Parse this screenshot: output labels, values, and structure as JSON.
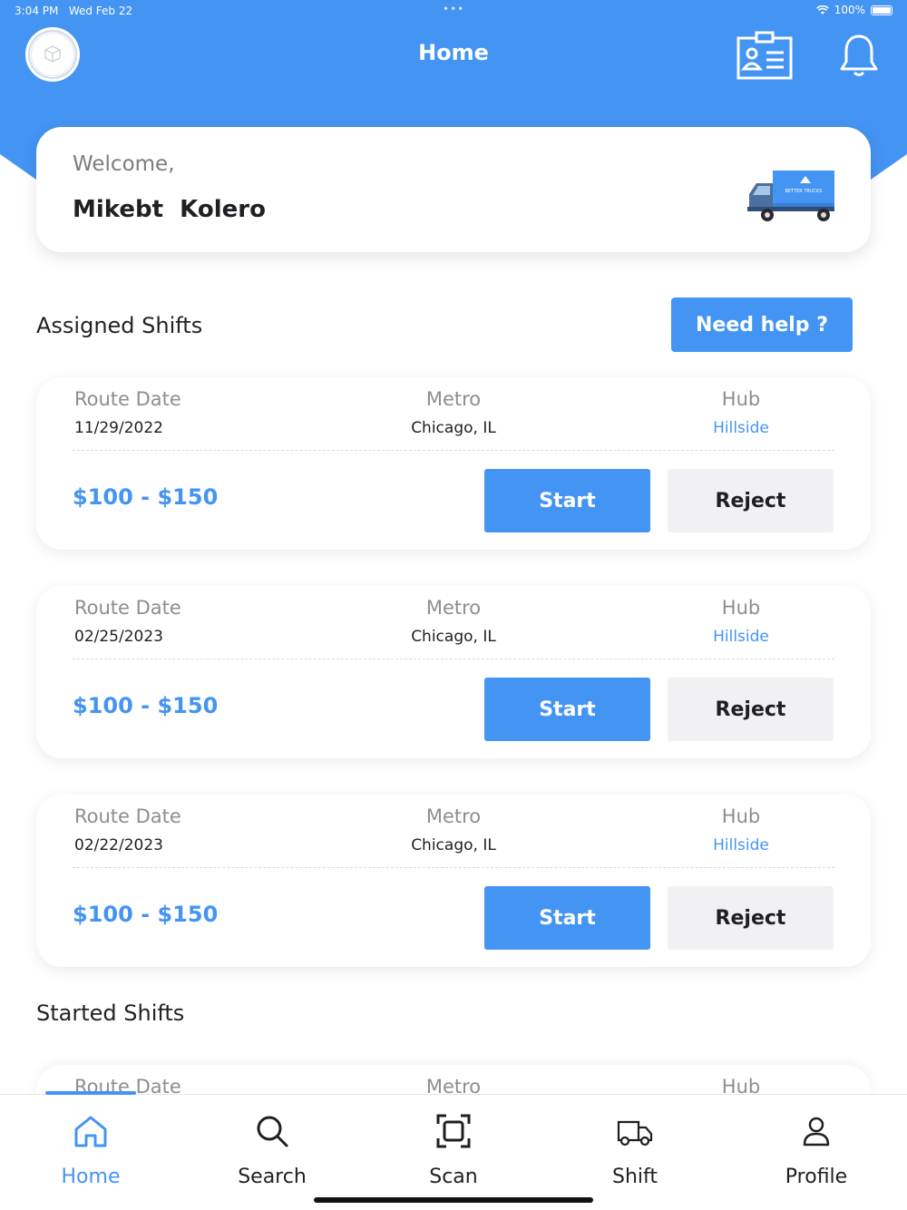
{
  "status_bar": {
    "time": "3:04 PM",
    "date": "Wed Feb 22",
    "battery": "100%"
  },
  "header": {
    "title": "Home"
  },
  "welcome": {
    "greeting": "Welcome,",
    "name": "Mikebt  Kolero",
    "truck_brand": "BETTER TRUCKS"
  },
  "assigned": {
    "title": "Assigned Shifts",
    "help_label": "Need help ?",
    "shifts": [
      {
        "route_date_label": "Route Date",
        "route_date": "11/29/2022",
        "metro_label": "Metro",
        "metro": "Chicago, IL",
        "hub_label": "Hub",
        "hub": "Hillside",
        "price": "$100 - $150",
        "start_label": "Start",
        "reject_label": "Reject"
      },
      {
        "route_date_label": "Route Date",
        "route_date": "02/25/2023",
        "metro_label": "Metro",
        "metro": "Chicago, IL",
        "hub_label": "Hub",
        "hub": "Hillside",
        "price": "$100 - $150",
        "start_label": "Start",
        "reject_label": "Reject"
      },
      {
        "route_date_label": "Route Date",
        "route_date": "02/22/2023",
        "metro_label": "Metro",
        "metro": "Chicago, IL",
        "hub_label": "Hub",
        "hub": "Hillside",
        "price": "$100 - $150",
        "start_label": "Start",
        "reject_label": "Reject"
      }
    ]
  },
  "started": {
    "title": "Started Shifts",
    "partial": {
      "route_date_label": "Route Date",
      "metro_label": "Metro",
      "hub_label": "Hub"
    }
  },
  "tabs": [
    {
      "label": "Home",
      "icon": "home-icon",
      "active": true
    },
    {
      "label": "Search",
      "icon": "search-icon",
      "active": false
    },
    {
      "label": "Scan",
      "icon": "scan-icon",
      "active": false
    },
    {
      "label": "Shift",
      "icon": "truck-icon",
      "active": false
    },
    {
      "label": "Profile",
      "icon": "person-icon",
      "active": false
    }
  ],
  "colors": {
    "primary": "#4494f3",
    "reject_bg": "#f1f1f3",
    "text": "#1f1f24",
    "muted": "#8d8d93"
  }
}
